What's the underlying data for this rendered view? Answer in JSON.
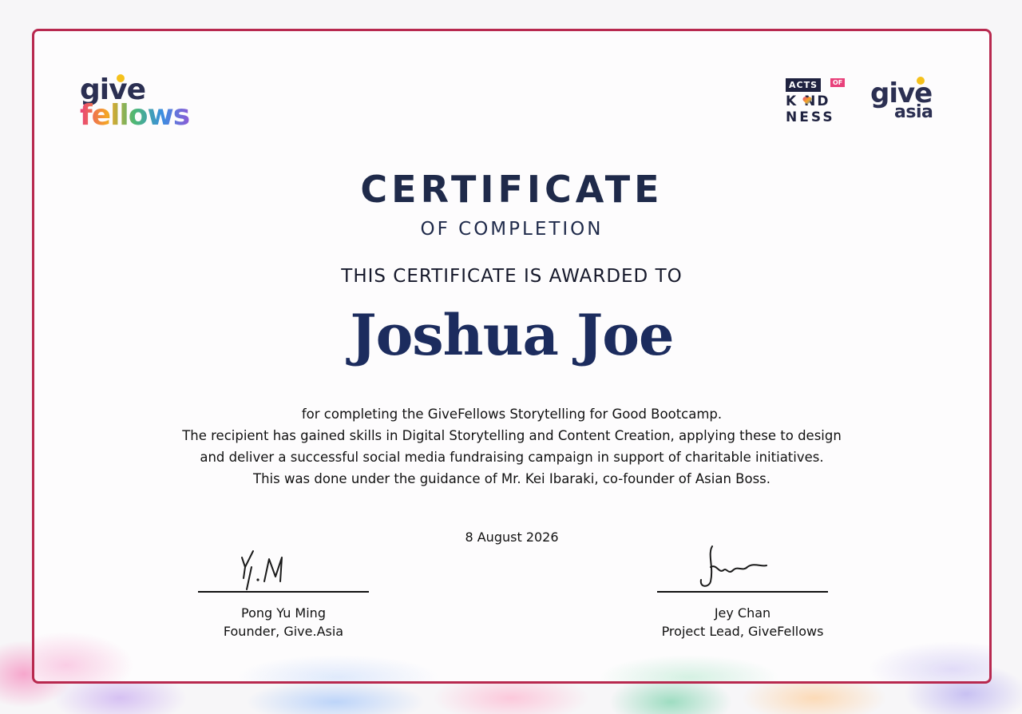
{
  "logos": {
    "givefellows": {
      "line1": "give",
      "line2": "fellows"
    },
    "acts_of_kindness": {
      "acts": "ACTS",
      "of": "OF",
      "kind": "K ND",
      "ness": "NESS"
    },
    "giveasia": {
      "give": "give",
      "asia": "asia"
    }
  },
  "certificate": {
    "title": "CERTIFICATE",
    "subtitle": "OF COMPLETION",
    "awarded_to": "THIS CERTIFICATE IS AWARDED TO",
    "recipient": "Joshua Joe",
    "description": [
      "for completing the GiveFellows Storytelling for Good Bootcamp.",
      "The recipient has gained skills in Digital Storytelling and Content Creation, applying these to design",
      "and deliver a successful social media fundraising campaign in support of charitable initiatives.",
      "This was done under the guidance of Mr. Kei Ibaraki, co-founder of Asian Boss."
    ],
    "date": "8 August 2026"
  },
  "signatories": [
    {
      "name": "Pong Yu Ming",
      "title": "Founder, Give.Asia"
    },
    {
      "name": "Jey Chan",
      "title": "Project Lead, GiveFellows"
    }
  ],
  "colors": {
    "border": "#b8294f",
    "title": "#1f2a4a",
    "recipient": "#1c2c5e"
  }
}
